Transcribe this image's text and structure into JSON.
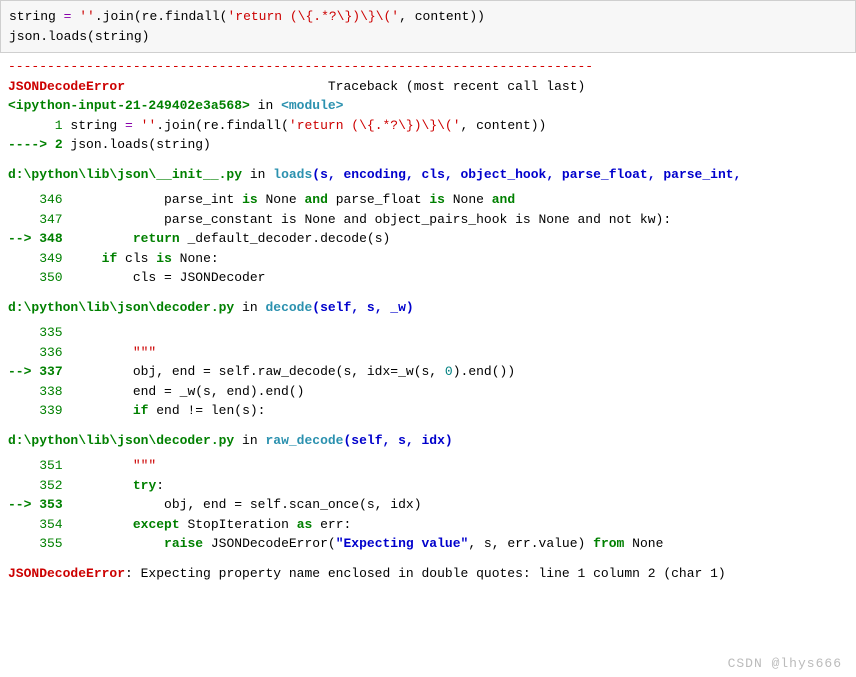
{
  "input": {
    "line1_a": "string ",
    "line1_op": "=",
    "line1_b": " ",
    "line1_str1": "''",
    "line1_c": ".join(re.findall(",
    "line1_str2": "'return (\\{.*?\\})\\}\\('",
    "line1_d": ", content))",
    "line2": "json.loads(string)"
  },
  "hr": "---------------------------------------------------------------------------",
  "err_header": {
    "name": "JSONDecodeError",
    "tb": "Traceback (most recent call last)"
  },
  "frame_input": {
    "loc": "<ipython-input-21-249402e3a568>",
    "in": " in ",
    "mod": "<module>",
    "l1_gut": "      1 ",
    "l1_a": "string ",
    "l1_op": "=",
    "l1_b": " ",
    "l1_s1": "''",
    "l1_c": ".join(re.findall(",
    "l1_s2": "'return (\\{.*?\\})\\}\\('",
    "l1_d": ", content))",
    "l2_arrow": "----> ",
    "l2_gut": "2 ",
    "l2": "json.loads(string)"
  },
  "frame_init": {
    "path": "d:\\python\\lib\\json\\__init__.py",
    "in": " in ",
    "fn": "loads",
    "sig": "(s, encoding, cls, object_hook, parse_float, parse_int,",
    "rows": {
      "346_gut": "    346 ",
      "346_a": "            parse_int ",
      "346_b": "is",
      "346_c": " None ",
      "346_d": "and",
      "346_e": " parse_float ",
      "346_f": "is",
      "346_g": " None ",
      "346_h": "and",
      "347_gut": "    347 ",
      "347": "            parse_constant is None and object_pairs_hook is None and not kw):",
      "348_arrow": "--> ",
      "348_gut": "348 ",
      "348_a": "        ",
      "348_b": "return",
      "348_c": " _default_decoder.decode(s)",
      "349_gut": "    349 ",
      "349_a": "    ",
      "349_b": "if",
      "349_c": " cls ",
      "349_d": "is",
      "349_e": " None:",
      "350_gut": "    350 ",
      "350": "        cls = JSONDecoder"
    }
  },
  "frame_decode": {
    "path": "d:\\python\\lib\\json\\decoder.py",
    "in": " in ",
    "fn": "decode",
    "sig": "(self, s, _w)",
    "rows": {
      "335_gut": "    335 ",
      "335": "",
      "336_gut": "    336 ",
      "336": "        \"\"\"",
      "337_arrow": "--> ",
      "337_gut": "337 ",
      "337_a": "        obj, end = self.raw_decode(s, idx=_w(s, ",
      "337_b": "0",
      "337_c": ").end())",
      "338_gut": "    338 ",
      "338": "        end = _w(s, end).end()",
      "339_gut": "    339 ",
      "339_a": "        ",
      "339_b": "if",
      "339_c": " end != len(s):"
    }
  },
  "frame_raw": {
    "path": "d:\\python\\lib\\json\\decoder.py",
    "in": " in ",
    "fn": "raw_decode",
    "sig": "(self, s, idx)",
    "rows": {
      "351_gut": "    351 ",
      "351": "        \"\"\"",
      "352_gut": "    352 ",
      "352_a": "        ",
      "352_b": "try",
      "352_c": ":",
      "353_arrow": "--> ",
      "353_gut": "353 ",
      "353": "            obj, end = self.scan_once(s, idx)",
      "354_gut": "    354 ",
      "354_a": "        ",
      "354_b": "except",
      "354_c": " StopIteration ",
      "354_d": "as",
      "354_e": " err:",
      "355_gut": "    355 ",
      "355_a": "            ",
      "355_b": "raise",
      "355_c": " JSONDecodeError(",
      "355_d": "\"Expecting value\"",
      "355_e": ", s, err.value) ",
      "355_f": "from",
      "355_g": " None"
    }
  },
  "final": {
    "name": "JSONDecodeError",
    "msg": ": Expecting property name enclosed in double quotes: line 1 column 2 (char 1)"
  },
  "watermark": "CSDN @lhys666"
}
